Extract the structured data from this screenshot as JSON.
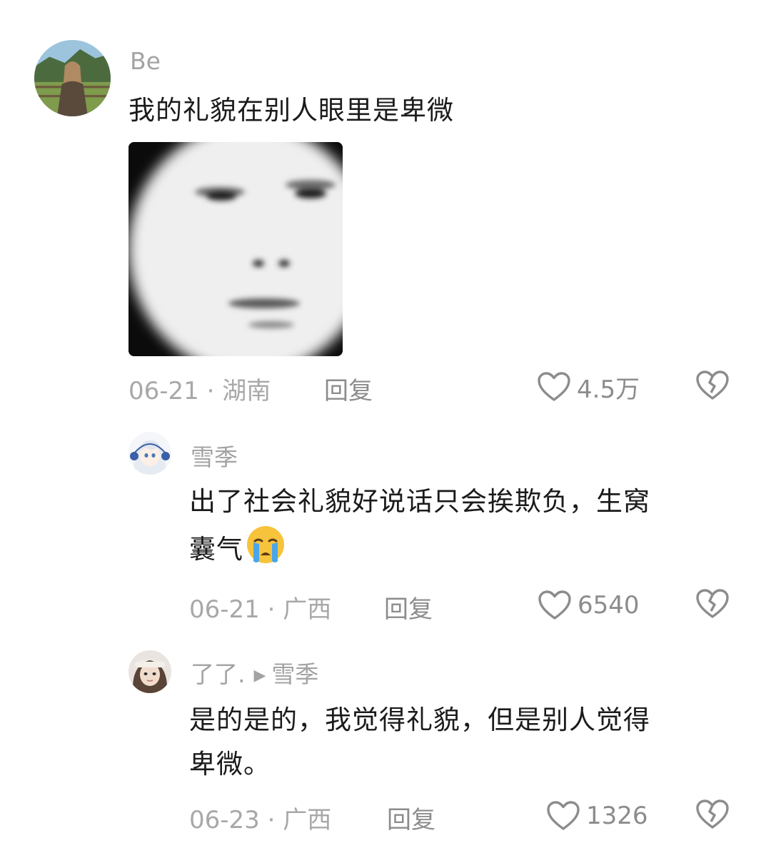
{
  "comments": [
    {
      "username": "Be",
      "text": "我的礼貌在别人眼里是卑微",
      "date": "06-21",
      "location": "湖南",
      "reply_label": "回复",
      "likes": "4.5万"
    },
    {
      "username": "雪季",
      "text_line1": "出了社会礼貌好说话只会挨欺负，生窝",
      "text_line2": "囊气",
      "emoji": "crying-face",
      "date": "06-21",
      "location": "广西",
      "reply_label": "回复",
      "likes": "6540"
    },
    {
      "username": "了了.",
      "reply_to": "雪季",
      "text_line1": "是的是的，我觉得礼貌，但是别人觉得",
      "text_line2": "卑微。",
      "date": "06-23",
      "location": "广西",
      "reply_label": "回复",
      "likes": "1326"
    }
  ],
  "separator": " · ",
  "colors": {
    "meta_gray": "#a8a8a8",
    "text": "#1b1b1b",
    "icon_gray": "#8c8c8c"
  }
}
